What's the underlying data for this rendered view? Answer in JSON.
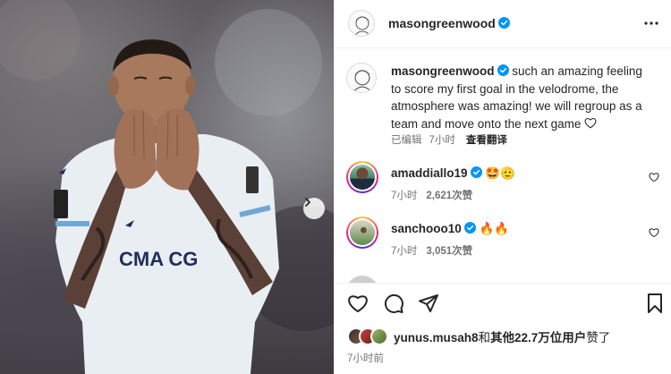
{
  "photo": {
    "shirt_sponsor": "CMA CG",
    "next_label": "Next"
  },
  "header": {
    "username": "masongreenwood",
    "verified_icon": "verified-badge-icon",
    "more_icon": "more-options-icon"
  },
  "caption": {
    "username": "masongreenwood",
    "text": "such an amazing feeling to score my first goal in the velodrome, the atmosphere was amazing! we will regroup as a team and move onto the next game",
    "edited": "已编辑",
    "time": "7小时",
    "translate": "查看翻译"
  },
  "comments": [
    {
      "username": "amaddiallo19",
      "text": "🤩🫡",
      "time": "7小时",
      "likes": "2,621次赞"
    },
    {
      "username": "sanchooo10",
      "text": "🔥🔥",
      "time": "7小时",
      "likes": "3,051次赞"
    }
  ],
  "actions": {
    "like_icon": "heart-icon",
    "comment_icon": "comment-icon",
    "share_icon": "share-icon",
    "save_icon": "bookmark-icon"
  },
  "likes_summary": {
    "user": "yunus.musah8",
    "joiner": "和",
    "others": "其他22.7万位用户",
    "suffix": "赞了"
  },
  "post_time": "7小时前",
  "colors": {
    "verified": "#0095f6",
    "meta": "#737373",
    "text": "#262626",
    "divider": "#efefef"
  }
}
